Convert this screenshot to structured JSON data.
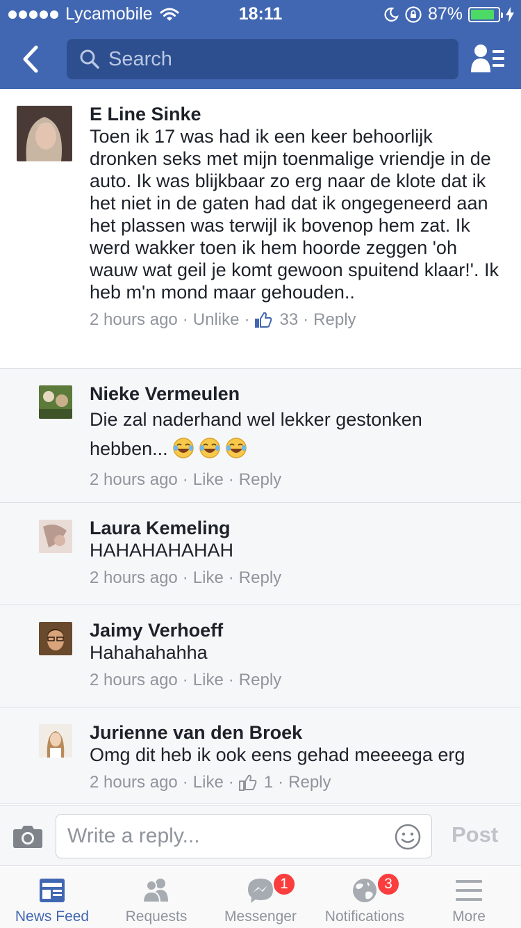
{
  "status_bar": {
    "carrier": "Lycamobile",
    "time": "18:11",
    "battery": "87%",
    "battery_level": 0.87
  },
  "nav": {
    "search_placeholder": "Search"
  },
  "comments": [
    {
      "name": "E Line Sinke",
      "text": "Toen ik 17 was had ik een keer behoorlijk dronken seks met mijn toenmalige vriendje in de auto. Ik was blijkbaar zo erg naar de klote dat ik het niet in de gaten had dat ik ongegeneerd aan het plassen was terwijl ik bovenop hem zat. Ik werd wakker toen ik hem hoorde zeggen 'oh wauw wat geil je komt gewoon spuitend klaar!'. Ik heb m'n mond maar gehouden..",
      "time": "2 hours ago",
      "like_action": "Unlike",
      "like_count": "33",
      "reply": "Reply"
    },
    {
      "name": "Nieke Vermeulen",
      "text": "Die zal naderhand wel lekker gestonken hebben...",
      "time": "2 hours ago",
      "like_action": "Like",
      "reply": "Reply"
    },
    {
      "name": "Laura Kemeling",
      "text": "HAHAHAHAHAH",
      "time": "2 hours ago",
      "like_action": "Like",
      "reply": "Reply"
    },
    {
      "name": "Jaimy Verhoeff",
      "text": "Hahahahahha",
      "time": "2 hours ago",
      "like_action": "Like",
      "reply": "Reply"
    },
    {
      "name": "Jurienne van den Broek",
      "text": "Omg dit heb ik ook eens gehad meeeega erg",
      "time": "2 hours ago",
      "like_action": "Like",
      "like_count": "1",
      "reply": "Reply"
    }
  ],
  "composer": {
    "placeholder": "Write a reply...",
    "post_label": "Post"
  },
  "tabs": [
    {
      "label": "News Feed",
      "icon": "news-feed-icon",
      "active": true
    },
    {
      "label": "Requests",
      "icon": "requests-icon"
    },
    {
      "label": "Messenger",
      "icon": "messenger-icon",
      "badge": "1"
    },
    {
      "label": "Notifications",
      "icon": "globe-icon",
      "badge": "3"
    },
    {
      "label": "More",
      "icon": "menu-icon"
    }
  ],
  "colors": {
    "brand": "#4267b2",
    "search_bg": "#2e4f8f",
    "reply_bg": "#f6f7f9",
    "meta_text": "#90949c",
    "badge": "#fa3e3e",
    "battery": "#4cd964"
  }
}
